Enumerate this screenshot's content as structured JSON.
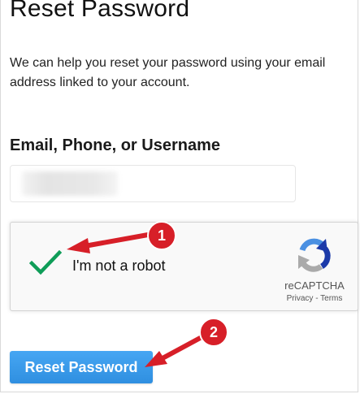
{
  "page": {
    "title": "Reset Password",
    "description": "We can help you reset your password using your email address linked to your account."
  },
  "form": {
    "field_label": "Email, Phone, or Username",
    "field_value": ""
  },
  "recaptcha": {
    "checkbox_label": "I'm not a robot",
    "checked": true,
    "brand": "reCAPTCHA",
    "privacy_link": "Privacy",
    "separator": " - ",
    "terms_link": "Terms",
    "check_color": "#0f9d58"
  },
  "actions": {
    "reset_label": "Reset Password",
    "button_color": "#3b9cee"
  },
  "annotations": [
    {
      "number": "1",
      "color": "#e0202a"
    },
    {
      "number": "2",
      "color": "#e0202a"
    }
  ]
}
